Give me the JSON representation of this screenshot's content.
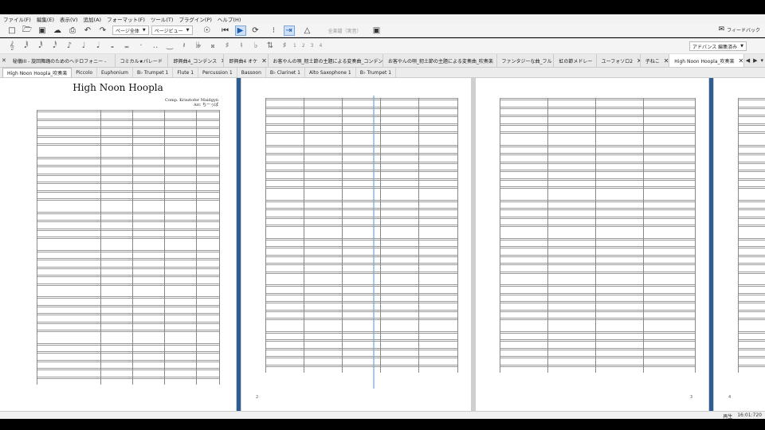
{
  "menu": [
    "ファイル(F)",
    "編集(E)",
    "表示(V)",
    "追加(A)",
    "フォーマット(F)",
    "ツール(T)",
    "プラグイン(P)",
    "ヘルプ(H)"
  ],
  "toolbar": {
    "view_mode": "ページ全体",
    "page_view": "ページビュー",
    "concert_pitch": "全楽譜（実音）",
    "feedback": "フィードバック"
  },
  "note_input": {
    "voices": [
      "1",
      "2",
      "3",
      "4"
    ],
    "workspace": "アドバンス 編集済み"
  },
  "doc_tabs": [
    "秘儀III - 旋回舞踊のためのヘテロフォニー -",
    "コミカル★パレード",
    "即興曲4_コンデンス",
    "即興曲4 オケ",
    "お客やんの唄_籾土節の主題による変奏曲_コンデンス",
    "お客やんの唄_籾土節の主題による変奏曲_吹奏楽",
    "ファンタジーな曲_フル",
    "虹の節メドレー",
    "ユーフォソロ2",
    "子ねこ",
    "High Noon Hoopla_吹奏楽"
  ],
  "parts": [
    "High Noon Hoopla_吹奏楽",
    "Piccolo",
    "Euphonium",
    "B♭ Trumpet 1",
    "Flute 1",
    "Percussion 1",
    "Bassoon",
    "B♭ Clarinet 1",
    "Alto Saxophone 1",
    "B♭ Trumpet 1"
  ],
  "score": {
    "title": "High Noon Hoopla",
    "composer": "Comp. Krisztofer Maidgyn",
    "arranger": "Arr. ちーっぱ",
    "page_numbers": [
      "2",
      "3",
      "4"
    ]
  },
  "status": {
    "mode": "再生",
    "time": "16:01:720"
  }
}
